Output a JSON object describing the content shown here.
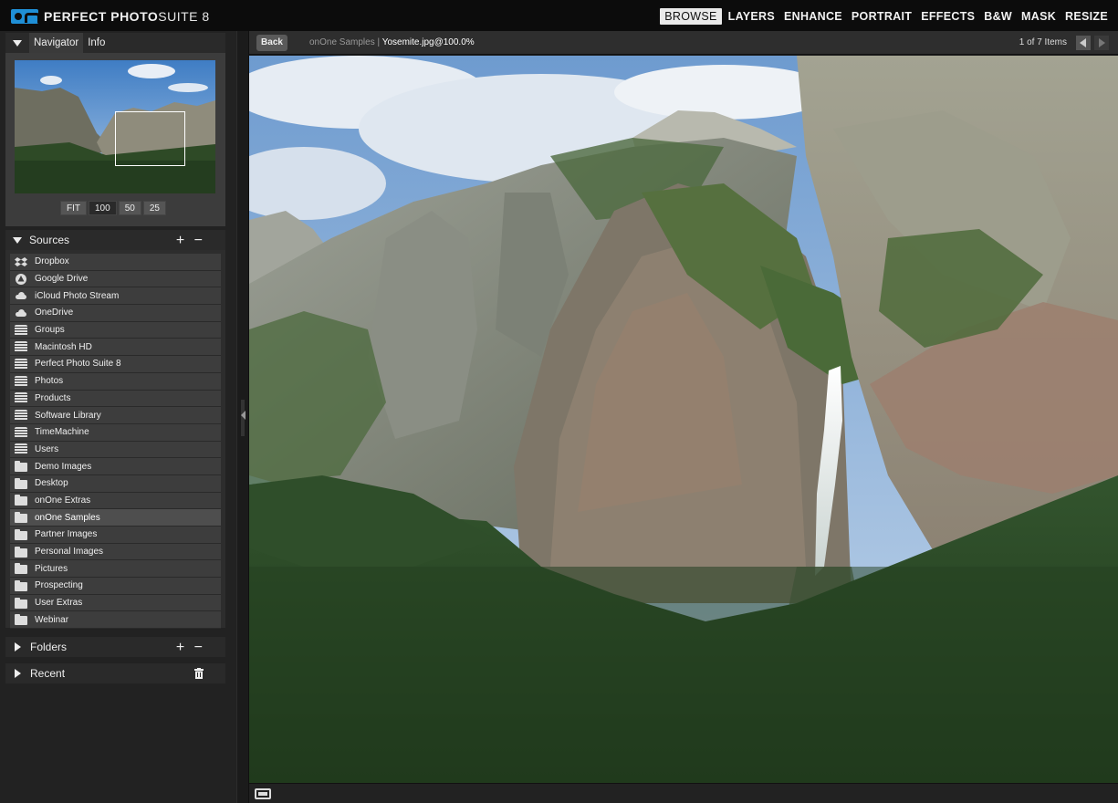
{
  "app": {
    "brand_name": "PERFECT PHOTO",
    "brand_suite": " SUITE 8"
  },
  "modules": [
    "BROWSE",
    "LAYERS",
    "ENHANCE",
    "PORTRAIT",
    "EFFECTS",
    "B&W",
    "MASK",
    "RESIZE"
  ],
  "active_module": "BROWSE",
  "navigator": {
    "tab_navigator": "Navigator",
    "tab_info": "Info",
    "zoom_options": [
      "FIT",
      "100",
      "50",
      "25"
    ],
    "zoom_selected": "100"
  },
  "sources": {
    "title": "Sources",
    "add_remove": "+ −",
    "selected": "onOne Samples",
    "items": [
      {
        "label": "Dropbox",
        "icon": "dropbox-icon"
      },
      {
        "label": "Google Drive",
        "icon": "google-drive-icon"
      },
      {
        "label": "iCloud Photo Stream",
        "icon": "cloud-icon"
      },
      {
        "label": "OneDrive",
        "icon": "cloud-icon"
      },
      {
        "label": "Groups",
        "icon": "disk-icon"
      },
      {
        "label": "Macintosh HD",
        "icon": "disk-icon"
      },
      {
        "label": "Perfect Photo Suite 8",
        "icon": "disk-icon"
      },
      {
        "label": "Photos",
        "icon": "disk-icon"
      },
      {
        "label": "Products",
        "icon": "disk-icon"
      },
      {
        "label": "Software Library",
        "icon": "disk-icon"
      },
      {
        "label": "TimeMachine",
        "icon": "disk-icon"
      },
      {
        "label": "Users",
        "icon": "disk-icon"
      },
      {
        "label": "Demo Images",
        "icon": "folder-icon"
      },
      {
        "label": "Desktop",
        "icon": "folder-icon"
      },
      {
        "label": "onOne Extras",
        "icon": "folder-icon"
      },
      {
        "label": "onOne Samples",
        "icon": "folder-icon"
      },
      {
        "label": "Partner Images",
        "icon": "folder-icon"
      },
      {
        "label": "Personal Images",
        "icon": "folder-icon"
      },
      {
        "label": "Pictures",
        "icon": "folder-icon"
      },
      {
        "label": "Prospecting",
        "icon": "folder-icon"
      },
      {
        "label": "User Extras",
        "icon": "folder-icon"
      },
      {
        "label": "Webinar",
        "icon": "folder-icon"
      }
    ]
  },
  "folders": {
    "title": "Folders",
    "add_remove": "+ −"
  },
  "recent": {
    "title": "Recent"
  },
  "viewer": {
    "back_label": "Back",
    "crumb_folder": "onOne Samples",
    "crumb_sep": " | ",
    "crumb_file": "Yosemite.jpg@100.0%",
    "items_count": "1 of 7 Items"
  },
  "colors": {
    "accent": "#1f8fd6",
    "panel_bg": "#222222",
    "list_item_bg": "#3d3d3d",
    "selected_bg": "#4e4e4e"
  }
}
